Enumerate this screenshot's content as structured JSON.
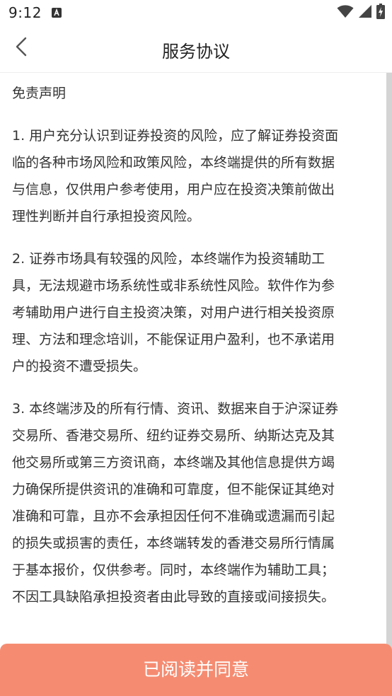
{
  "status_bar": {
    "time": "9:12",
    "notification_icon": "a-box-icon",
    "icons": [
      "wifi-icon",
      "signal-icon",
      "battery-charging-icon"
    ]
  },
  "nav": {
    "back_icon": "chevron-left-icon",
    "title": "服务协议"
  },
  "document": {
    "heading": "免责声明",
    "paragraphs": [
      {
        "lines": [
          "1. 用户充分认识到证券投资的风险，应了解证券投资面",
          "临的各种市场风险和政策风险，本终端提供的所有数据",
          "与信息，仅供用户参考使用，用户应在投资决策前做出",
          "理性判断并自行承担投资风险。"
        ]
      },
      {
        "lines": [
          "2. 证券市场具有较强的风险，本终端作为投资辅助工",
          "具，无法规避市场系统性或非系统性风险。软件作为参",
          "考辅助用户进行自主投资决策，对用户进行相关投资原",
          "理、方法和理念培训，不能保证用户盈利，也不承诺用",
          "户的投资不遭受损失。"
        ]
      },
      {
        "lines": [
          "3. 本终端涉及的所有行情、资讯、数据来自于沪深证券",
          "交易所、香港交易所、纽约证券交易所、纳斯达克及其",
          "他交易所或第三方资讯商，本终端及其他信息提供方竭",
          "力确保所提供资讯的准确和可靠度，但不能保证其绝对",
          "准确和可靠，且亦不会承担因任何不准确或遗漏而引起",
          "的损失或损害的责任，本终端转发的香港交易所行情属",
          "于基本报价，仅供参考。同时，本终端作为辅助工具；",
          "不因工具缺陷承担投资者由此导致的直接或间接损失。"
        ]
      }
    ]
  },
  "footer": {
    "agree_label": "已阅读并同意"
  },
  "colors": {
    "accent": "#f58c72",
    "text": "#333333",
    "title": "#222222"
  }
}
